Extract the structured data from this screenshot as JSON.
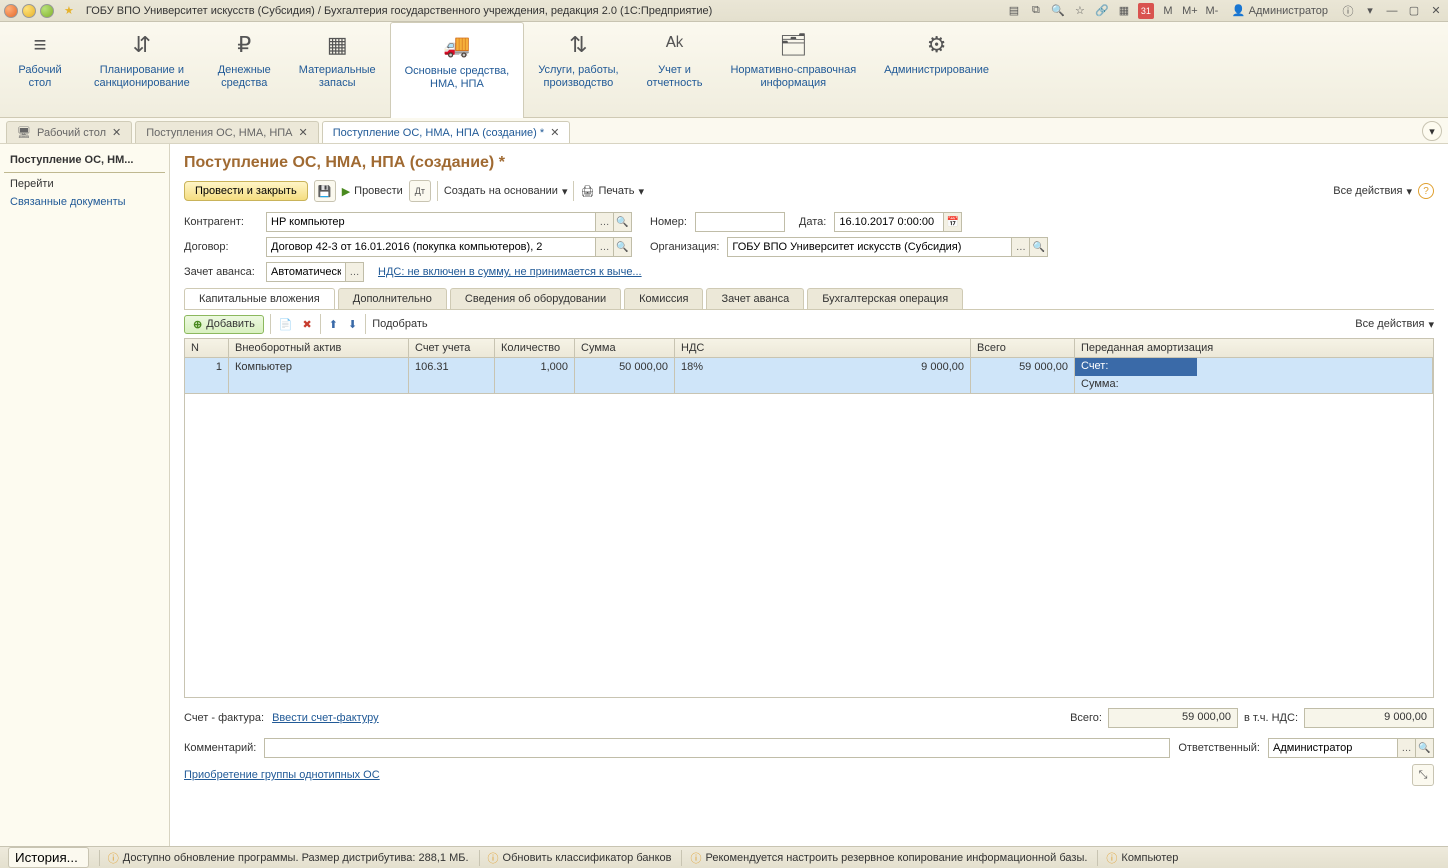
{
  "titlebar": {
    "text": "ГОБУ ВПО Университет искусств (Субсидия) / Бухгалтерия государственного учреждения, редакция 2.0  (1С:Предприятие)",
    "user": "Администратор",
    "m": "M",
    "mplus": "M+",
    "mminus": "M-",
    "cal": "31"
  },
  "ribbon": [
    {
      "label": "Рабочий\nстол"
    },
    {
      "label": "Планирование и\nсанкционирование"
    },
    {
      "label": "Денежные\nсредства"
    },
    {
      "label": "Материальные\nзапасы"
    },
    {
      "label": "Основные средства,\nНМА, НПА",
      "active": true
    },
    {
      "label": "Услуги, работы,\nпроизводство"
    },
    {
      "label": "Учет и\nотчетность"
    },
    {
      "label": "Нормативно-справочная\nинформация"
    },
    {
      "label": "Администрирование"
    }
  ],
  "tabs": [
    {
      "label": "Рабочий стол"
    },
    {
      "label": "Поступления ОС, НМА, НПА"
    },
    {
      "label": "Поступление ОС, НМА, НПА (создание) *",
      "active": true
    }
  ],
  "sidebar": {
    "title": "Поступление ОС, НМ...",
    "group": "Перейти",
    "link1": "Связанные документы"
  },
  "page": {
    "title": "Поступление ОС, НМА, НПА (создание) *"
  },
  "tb": {
    "post_close": "Провести и закрыть",
    "post": "Провести",
    "create_based": "Создать на основании",
    "print": "Печать",
    "all_actions": "Все действия"
  },
  "form": {
    "lbl_contractor": "Контрагент:",
    "contractor": "HP компьютер",
    "lbl_contract": "Договор:",
    "contract": "Договор 42-3 от 16.01.2016 (покупка компьютеров), 2",
    "lbl_advance": "Зачет аванса:",
    "advance": "Автоматически",
    "vat_link": "НДС: не включен в сумму, не принимается к выче...",
    "lbl_number": "Номер:",
    "number": "",
    "lbl_date": "Дата:",
    "date": "16.10.2017 0:00:00",
    "lbl_org": "Организация:",
    "org": "ГОБУ ВПО Университет искусств (Субсидия)"
  },
  "subtabs": [
    "Капитальные вложения",
    "Дополнительно",
    "Сведения об оборудовании",
    "Комиссия",
    "Зачет аванса",
    "Бухгалтерская операция"
  ],
  "gridtb": {
    "add": "Добавить",
    "pick": "Подобрать",
    "all_actions": "Все действия"
  },
  "grid": {
    "headers": [
      "N",
      "Внеоборотный актив",
      "Счет учета",
      "Количество",
      "Сумма",
      "НДС",
      "Всего",
      "Переданная амортизация"
    ],
    "row": {
      "n": "1",
      "asset": "Компьютер",
      "acct": "106.31",
      "qty": "1,000",
      "sum": "50 000,00",
      "nds": "18%",
      "nds_amt": "9 000,00",
      "total": "59 000,00",
      "amort_acct": "Счет:",
      "amort_sum": "Сумма:"
    }
  },
  "bottom": {
    "lbl_invoice": "Счет - фактура:",
    "invoice_link": "Ввести счет-фактуру",
    "lbl_total": "Всего:",
    "total": "59 000,00",
    "lbl_incl_vat": "в т.ч. НДС:",
    "vat": "9 000,00",
    "lbl_comment": "Комментарий:",
    "comment": "",
    "lbl_resp": "Ответственный:",
    "resp": "Администратор",
    "group_link": "Приобретение группы однотипных ОС"
  },
  "status": {
    "history": "История...",
    "upd": "Доступно обновление программы. Размер дистрибутива: 288,1 МБ.",
    "banks": "Обновить классификатор банков",
    "backup": "Рекомендуется настроить резервное копирование информационной базы.",
    "pc": "Компьютер"
  }
}
